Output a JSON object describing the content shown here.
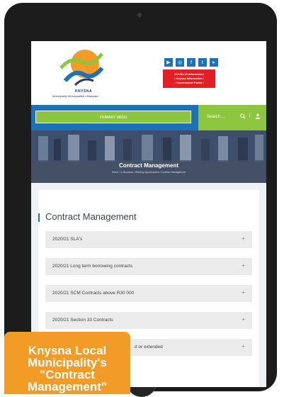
{
  "header": {
    "logo_name": "KNYSNA",
    "logo_tagline": "Municipality  Munisipaliteit  uMasipala",
    "social_icons": [
      "play-icon",
      "camera-icon",
      "facebook-icon",
      "twitter-icon",
      "youtube-icon"
    ],
    "covid_lines": [
      "COVID-19 Information",
      "• Knysna Information •",
      "• Government Portal •"
    ]
  },
  "navbar": {
    "primary_menu": "PRIMARY MENU",
    "search_placeholder": "Search ...",
    "separator": "|"
  },
  "hero": {
    "title": "Contract Management",
    "breadcrumb": "Home / In Business / Bidding Opportunities / Contract Management"
  },
  "page": {
    "heading": "Contract Management",
    "accordion": [
      {
        "label": "2020/21 SLA's"
      },
      {
        "label": "2020/21 Long term borrowing contracts"
      },
      {
        "label": "2020/21 SCM Contracts above R30 000"
      },
      {
        "label": "2020/21 Section 33 Contracts"
      },
      {
        "label": "d or extended"
      }
    ],
    "plus_symbol": "+"
  },
  "caption": {
    "text": "Knysna Local Municipality's \"Contract Management\""
  },
  "colors": {
    "brand_blue": "#1d71b8",
    "brand_green": "#8cc63f",
    "covid_red": "#e31e24",
    "caption_orange": "#f29b26"
  }
}
